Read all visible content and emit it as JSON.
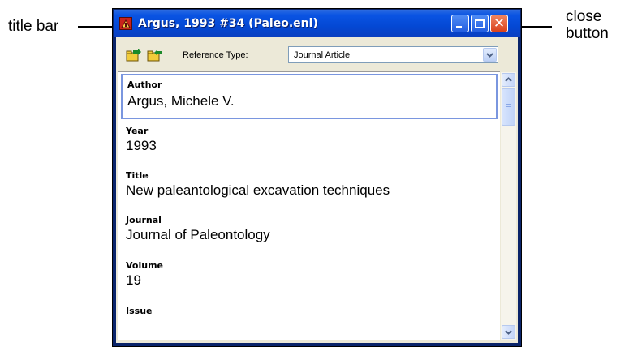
{
  "callouts": {
    "title_bar": "title bar",
    "close_button_line1": "close",
    "close_button_line2": "button"
  },
  "window": {
    "title": "Argus, 1993 #34 (Paleo.enl)",
    "icons": {
      "app": "endnote-app-icon",
      "minimize": "minimize-icon",
      "maximize": "maximize-icon",
      "close": "close-icon"
    },
    "close_glyph": "✕"
  },
  "toolbar": {
    "tool_icons": [
      "folder-arrow-icon",
      "folder-arrow-icon"
    ],
    "reference_type_label": "Reference Type:",
    "reference_type_value": "Journal Article"
  },
  "fields": [
    {
      "label": "Author",
      "value": "Argus, Michele V."
    },
    {
      "label": "Year",
      "value": "1993"
    },
    {
      "label": "Title",
      "value": "New paleantological excavation techniques"
    },
    {
      "label": "Journal",
      "value": "Journal of Paleontology"
    },
    {
      "label": "Volume",
      "value": "19"
    },
    {
      "label": "Issue",
      "value": ""
    }
  ],
  "colors": {
    "titlebar": "#0a54e3",
    "close_button": "#d9411c",
    "active_field_border": "#7a96df",
    "window_face": "#ece9d8"
  }
}
